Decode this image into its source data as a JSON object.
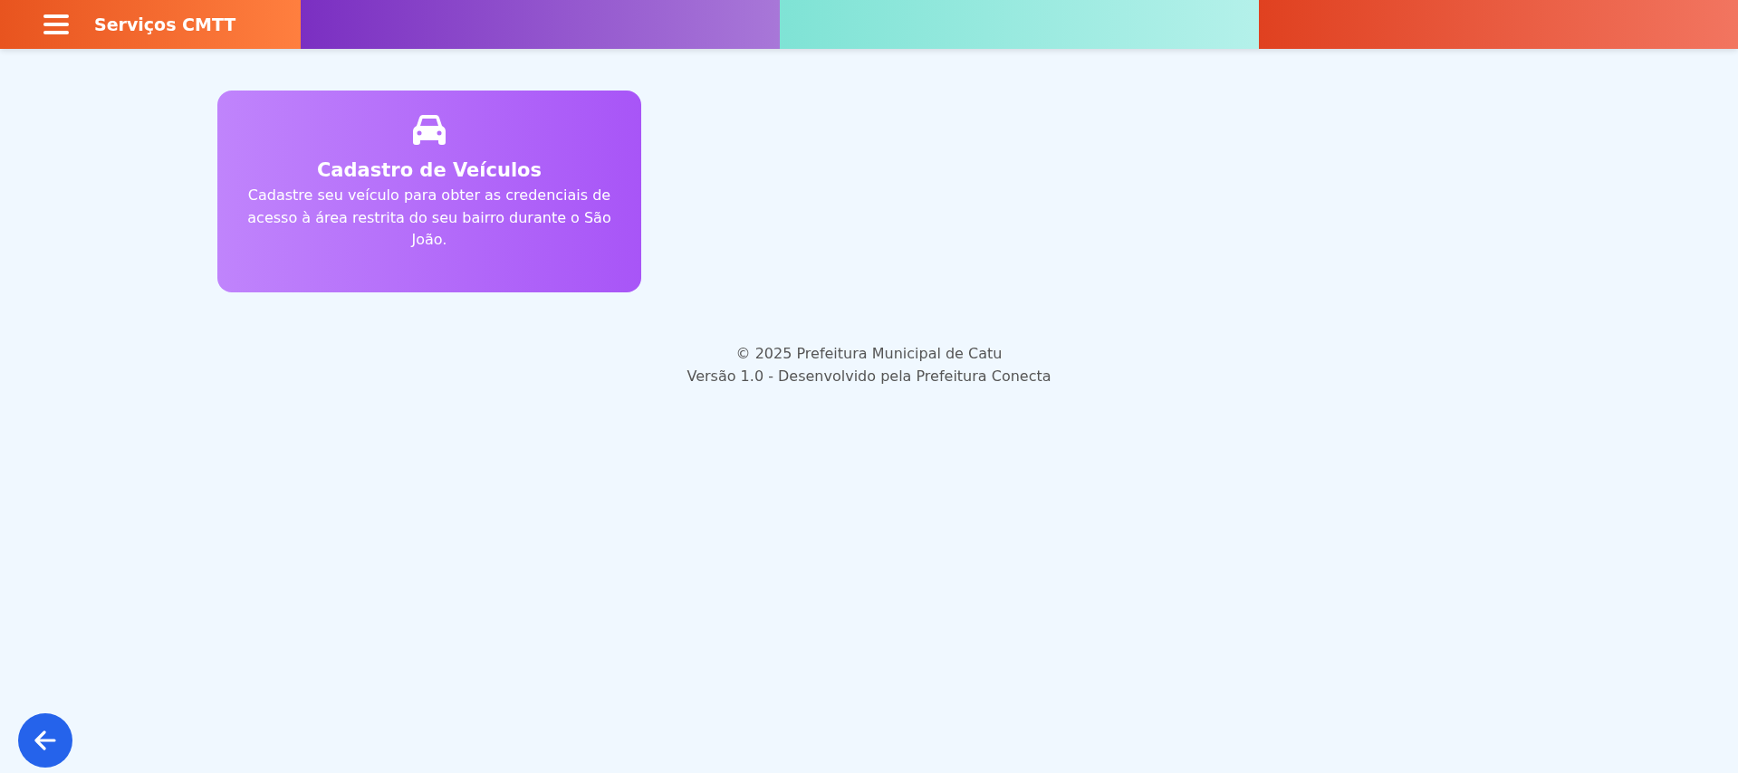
{
  "header": {
    "title": "Serviços CMTT"
  },
  "services": [
    {
      "kind": "vehicle",
      "title": "Cadastro de Veículos",
      "description": "Cadastre seu veículo para obter as credenciais de acesso à área restrita do seu bairro durante o São João."
    }
  ],
  "footer": {
    "lines": [
      "© 2025 Prefeitura Municipal de Catu",
      "Versão 1.0 - Desenvolvido pela Prefeitura Conecta"
    ]
  }
}
